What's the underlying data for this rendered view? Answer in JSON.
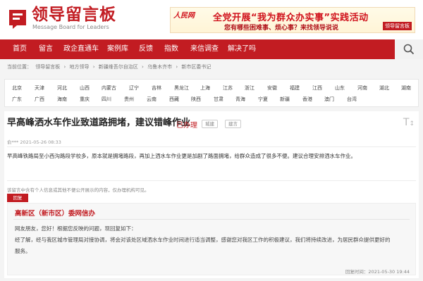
{
  "brand": {
    "title": "领导留言板",
    "subtitle": "Message Board for Leaders",
    "color": "#c21c22"
  },
  "banner": {
    "logo": "人民网",
    "headline": "全党开展“我为群众办实事”实践活动",
    "subline": "您有哪些困难事、烦心事？来找领导说说",
    "badge": "领导留言板"
  },
  "nav": {
    "items": [
      "首页",
      "留言",
      "政企直通车",
      "案例库",
      "反馈",
      "指数",
      "来信调查",
      "解决了吗"
    ],
    "search_icon": "search-icon"
  },
  "breadcrumb": {
    "items": [
      "当前位置：",
      "领导留言板",
      "›",
      "地方领导",
      "›",
      "新疆维吾尔自治区",
      "›",
      "乌鲁木齐市",
      "›",
      "新市区委书记"
    ]
  },
  "regions": [
    [
      "北京",
      "天津",
      "河北",
      "山西",
      "内蒙古",
      "辽宁",
      "吉林",
      "黑龙江",
      "上海",
      "江苏",
      "浙江",
      "安徽",
      "福建",
      "江西",
      "山东",
      "河南",
      "湖北",
      "湖南"
    ],
    [
      "广东",
      "广西",
      "海南",
      "重庆",
      "四川",
      "贵州",
      "云南",
      "西藏",
      "陕西",
      "甘肃",
      "青海",
      "宁夏",
      "新疆",
      "香港",
      "澳门",
      "台湾"
    ]
  ],
  "post": {
    "title": "早高峰洒水车作业致道路拥堵，建议错峰作业",
    "status": "已办理",
    "tags": [
      "城建",
      "建言"
    ],
    "meta": "俞*** 2021-05-26 08:33",
    "body": "早高峰铁路局至小西沟路段学校多，原本就是拥堵路段，再加上洒水车作业更是加剧了路面拥堵，给群众造成了很多不便。建议合理安排洒水车作业。",
    "notice": "该留言中含有个人信息或其他不便公开展示的内容，仅办理机构可见。"
  },
  "reply": {
    "tag": "回复",
    "org": "高新区（新市区）委网信办",
    "lines": [
      "网友朋友，您好！根据您反映的问题，现回复如下：",
      "    经了解，经与我区城市管理局对接协调，将会对该处区域洒水车作业时间进行适当调整，感谢您对我区工作的积极建议，我们将持续改进，为居民群众提供更好的",
      "服务。"
    ],
    "date_label": "回复时间：",
    "date": "2021-05-30 19:44"
  }
}
